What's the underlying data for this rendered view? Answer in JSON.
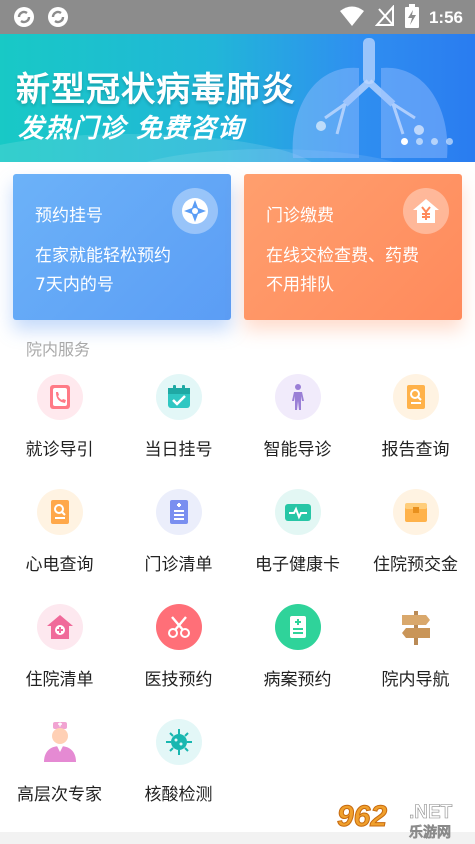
{
  "status_bar": {
    "time": "1:56"
  },
  "banner": {
    "title": "新型冠状病毒肺炎",
    "subtitle": "发热门诊 免费咨询",
    "slide_count": 4,
    "active_slide": 1
  },
  "cards": [
    {
      "title": "预约挂号",
      "desc_line1": "在家就能轻松预约",
      "desc_line2": "7天内的号",
      "icon": "compass-icon",
      "color": "#5b9df5"
    },
    {
      "title": "门诊缴费",
      "desc_line1": "在线交检查费、药费",
      "desc_line2": "不用排队",
      "icon": "yuan-house-icon",
      "color": "#ff8a5c"
    }
  ],
  "section": {
    "title": "院内服务"
  },
  "services": [
    {
      "label": "就诊导引",
      "icon": "phone-book-icon",
      "bg": "#ffe9ee"
    },
    {
      "label": "当日挂号",
      "icon": "calendar-check-icon",
      "bg": "#e3f7f7"
    },
    {
      "label": "智能导诊",
      "icon": "human-body-icon",
      "bg": "#f1ebfb"
    },
    {
      "label": "报告查询",
      "icon": "report-search-icon",
      "bg": "#fff3e2"
    },
    {
      "label": "心电查询",
      "icon": "ecg-report-icon",
      "bg": "#fff3e2"
    },
    {
      "label": "门诊清单",
      "icon": "list-icon",
      "bg": "#ebeefb"
    },
    {
      "label": "电子健康卡",
      "icon": "health-card-icon",
      "bg": "#e3f7f4"
    },
    {
      "label": "住院预交金",
      "icon": "deposit-box-icon",
      "bg": "#fff3e2"
    },
    {
      "label": "住院清单",
      "icon": "hospital-house-icon",
      "bg": "#fde8ef"
    },
    {
      "label": "医技预约",
      "icon": "scissors-icon",
      "bg": "#ff6f78"
    },
    {
      "label": "病案预约",
      "icon": "medical-record-icon",
      "bg": "#2fd39a"
    },
    {
      "label": "院内导航",
      "icon": "signpost-icon",
      "bg": "#ffffff"
    },
    {
      "label": "高层次专家",
      "icon": "doctor-icon",
      "bg": "#ffffff"
    },
    {
      "label": "核酸检测",
      "icon": "virus-icon",
      "bg": "#e3f7f7"
    }
  ],
  "watermark": {
    "number": "962",
    "suffix": ".NET",
    "site": "乐游网"
  }
}
